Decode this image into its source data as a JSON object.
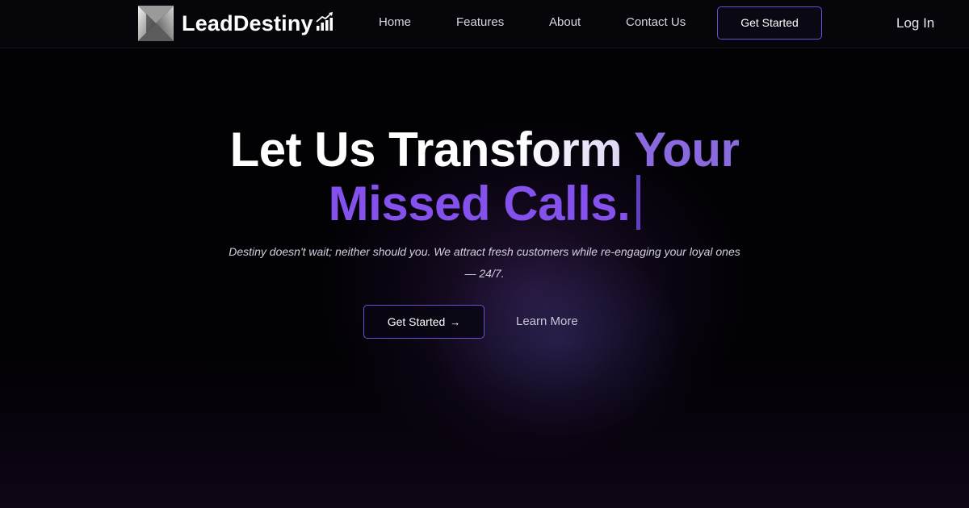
{
  "header": {
    "logo_text": "LeadDestiny",
    "nav": [
      "Home",
      "Features",
      "About",
      "Contact Us"
    ],
    "cta_label": "Get Started",
    "login_label": "Log In"
  },
  "hero": {
    "title_line1_a": "Let Us Trans",
    "title_line1_b": "form ",
    "title_line1_c": "Your",
    "title_line2": "Missed Calls.",
    "subtitle": "Destiny doesn't wait; neither should you. We attract fresh customers while re-engaging your loyal ones — 24/7.",
    "primary_label": "Get Started",
    "primary_icon": "arrow-right-icon",
    "secondary_label": "Learn More"
  },
  "colors": {
    "accent": "#8451ec",
    "button_border": "#6b4fd8",
    "background": "#020104"
  }
}
